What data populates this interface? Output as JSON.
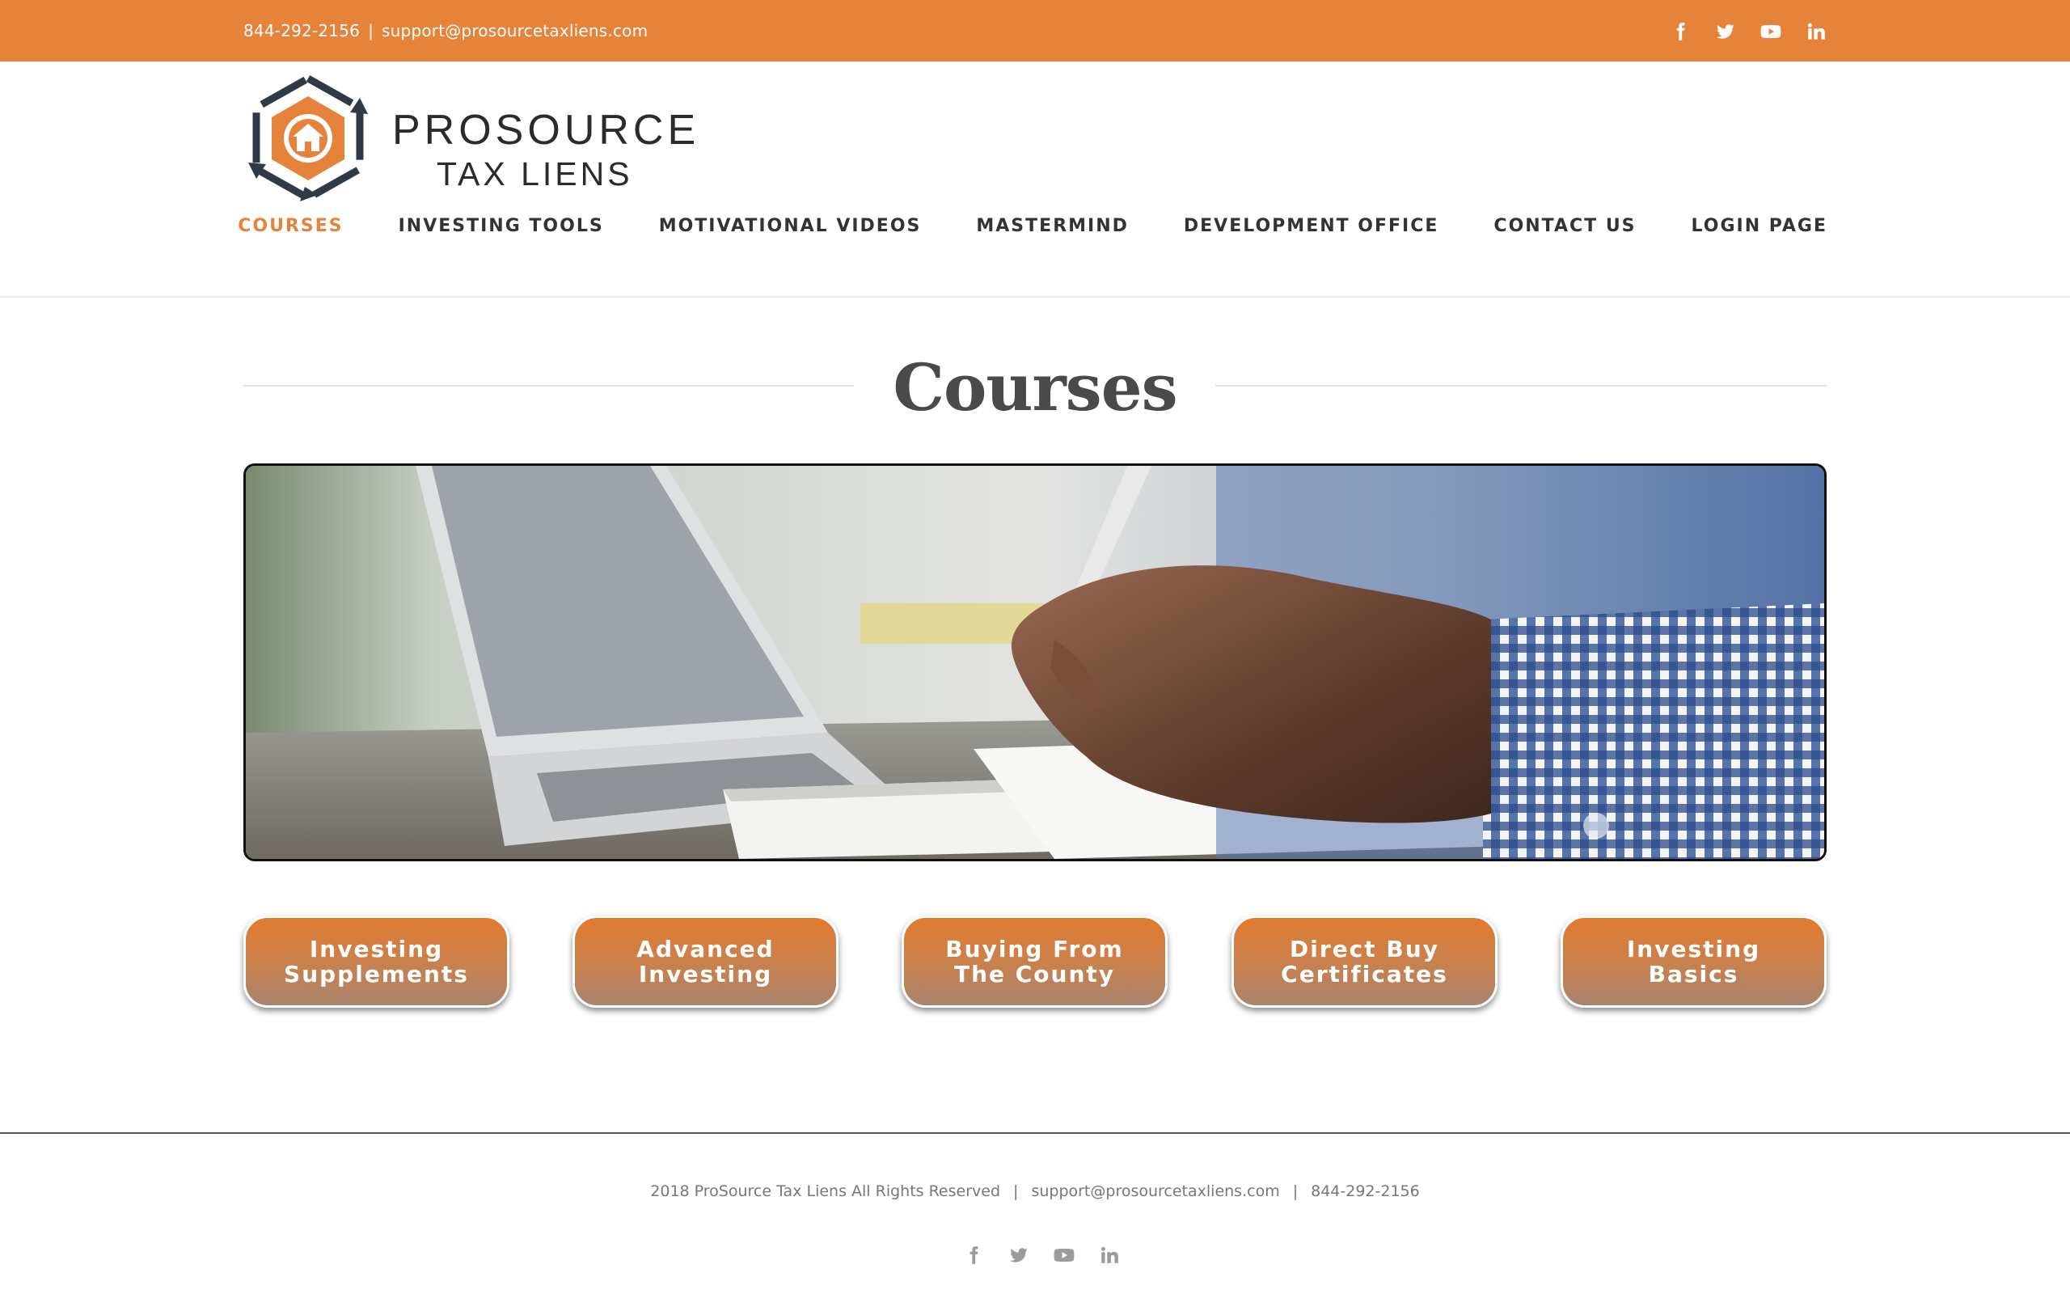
{
  "topbar": {
    "phone": "844-292-2156",
    "separator": "|",
    "email": "support@prosourcetaxliens.com",
    "social": [
      "facebook-icon",
      "twitter-icon",
      "youtube-icon",
      "linkedin-icon"
    ]
  },
  "logo": {
    "line1": "PROSOURCE",
    "line2": "TAX LIENS"
  },
  "nav": {
    "items": [
      {
        "label": "COURSES",
        "active": true
      },
      {
        "label": "INVESTING TOOLS"
      },
      {
        "label": "MOTIVATIONAL VIDEOS"
      },
      {
        "label": "MASTERMIND"
      },
      {
        "label": "DEVELOPMENT OFFICE"
      },
      {
        "label": "CONTACT US"
      },
      {
        "label": "LOGIN PAGE"
      }
    ]
  },
  "page": {
    "title": "Courses"
  },
  "courses": [
    {
      "line1": "Investing",
      "line2": "Supplements"
    },
    {
      "line1": "Advanced",
      "line2": "Investing"
    },
    {
      "line1": "Buying From",
      "line2": "The County"
    },
    {
      "line1": "Direct Buy",
      "line2": "Certificates"
    },
    {
      "line1": "Investing",
      "line2": "Basics"
    }
  ],
  "footer": {
    "copyright": "2018 ProSource Tax Liens All Rights Reserved",
    "separator": "|",
    "email": "support@prosourcetaxliens.com",
    "phone": "844-292-2156",
    "social": [
      "facebook-icon",
      "twitter-icon",
      "youtube-icon",
      "linkedin-icon"
    ]
  },
  "colors": {
    "accent": "#e5833b",
    "text": "#333333",
    "footer_text": "#777777"
  }
}
